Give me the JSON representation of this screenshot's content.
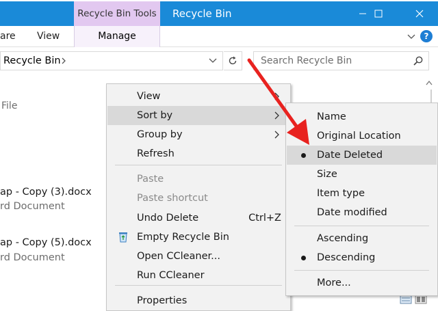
{
  "titlebar": {
    "contextual_tab": "Recycle Bin Tools",
    "window_title": "Recycle Bin",
    "minimize_icon": "minimize-icon",
    "maximize_icon": "maximize-icon",
    "close_icon": "close-icon",
    "color": "#1a8ad8",
    "contextual_color": "#e2c8f0"
  },
  "ribbon": {
    "tabs": [
      "are",
      "View",
      "Manage"
    ],
    "expand_icon": "chevron-down-icon",
    "help_label": "?"
  },
  "address": {
    "path": "Recycle Bin",
    "refresh_icon": "refresh-icon",
    "search_placeholder": "Search Recycle Bin"
  },
  "content": {
    "column_header": "File",
    "files": [
      {
        "name": "ap - Copy (3).docx",
        "type": "rd Document"
      },
      {
        "name": "ap - Copy (5).docx",
        "type": "rd Document"
      }
    ]
  },
  "context_menu": {
    "items": [
      {
        "label": "View",
        "submenu": true
      },
      {
        "label": "Sort by",
        "submenu": true,
        "highlighted": true
      },
      {
        "label": "Group by",
        "submenu": true
      },
      {
        "label": "Refresh"
      },
      {
        "label": "Paste",
        "disabled": true
      },
      {
        "label": "Paste shortcut",
        "disabled": true
      },
      {
        "label": "Undo Delete",
        "shortcut": "Ctrl+Z"
      },
      {
        "label": "Empty Recycle Bin",
        "icon": "recycle-bin-icon"
      },
      {
        "label": "Open CCleaner..."
      },
      {
        "label": "Run CCleaner"
      },
      {
        "label": "Properties"
      }
    ]
  },
  "sort_submenu": {
    "items": [
      {
        "label": "Name"
      },
      {
        "label": "Original Location"
      },
      {
        "label": "Date Deleted",
        "selected": true,
        "highlighted": true
      },
      {
        "label": "Size"
      },
      {
        "label": "Item type"
      },
      {
        "label": "Date modified"
      },
      {
        "label": "Ascending"
      },
      {
        "label": "Descending",
        "selected": true
      },
      {
        "label": "More..."
      }
    ]
  },
  "annotation": {
    "color": "#e8221f"
  }
}
